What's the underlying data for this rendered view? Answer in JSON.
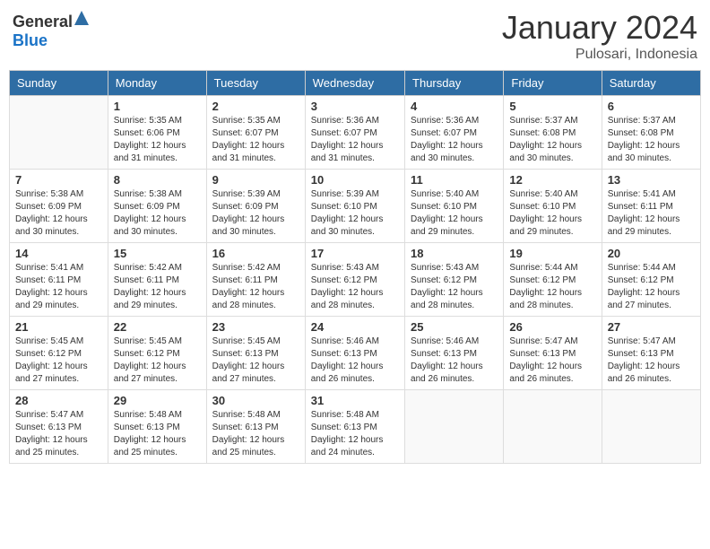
{
  "logo": {
    "text_general": "General",
    "text_blue": "Blue"
  },
  "title": "January 2024",
  "subtitle": "Pulosari, Indonesia",
  "days_of_week": [
    "Sunday",
    "Monday",
    "Tuesday",
    "Wednesday",
    "Thursday",
    "Friday",
    "Saturday"
  ],
  "weeks": [
    [
      {
        "day": "",
        "sunrise": "",
        "sunset": "",
        "daylight": ""
      },
      {
        "day": "1",
        "sunrise": "Sunrise: 5:35 AM",
        "sunset": "Sunset: 6:06 PM",
        "daylight": "Daylight: 12 hours and 31 minutes."
      },
      {
        "day": "2",
        "sunrise": "Sunrise: 5:35 AM",
        "sunset": "Sunset: 6:07 PM",
        "daylight": "Daylight: 12 hours and 31 minutes."
      },
      {
        "day": "3",
        "sunrise": "Sunrise: 5:36 AM",
        "sunset": "Sunset: 6:07 PM",
        "daylight": "Daylight: 12 hours and 31 minutes."
      },
      {
        "day": "4",
        "sunrise": "Sunrise: 5:36 AM",
        "sunset": "Sunset: 6:07 PM",
        "daylight": "Daylight: 12 hours and 30 minutes."
      },
      {
        "day": "5",
        "sunrise": "Sunrise: 5:37 AM",
        "sunset": "Sunset: 6:08 PM",
        "daylight": "Daylight: 12 hours and 30 minutes."
      },
      {
        "day": "6",
        "sunrise": "Sunrise: 5:37 AM",
        "sunset": "Sunset: 6:08 PM",
        "daylight": "Daylight: 12 hours and 30 minutes."
      }
    ],
    [
      {
        "day": "7",
        "sunrise": "Sunrise: 5:38 AM",
        "sunset": "Sunset: 6:09 PM",
        "daylight": "Daylight: 12 hours and 30 minutes."
      },
      {
        "day": "8",
        "sunrise": "Sunrise: 5:38 AM",
        "sunset": "Sunset: 6:09 PM",
        "daylight": "Daylight: 12 hours and 30 minutes."
      },
      {
        "day": "9",
        "sunrise": "Sunrise: 5:39 AM",
        "sunset": "Sunset: 6:09 PM",
        "daylight": "Daylight: 12 hours and 30 minutes."
      },
      {
        "day": "10",
        "sunrise": "Sunrise: 5:39 AM",
        "sunset": "Sunset: 6:10 PM",
        "daylight": "Daylight: 12 hours and 30 minutes."
      },
      {
        "day": "11",
        "sunrise": "Sunrise: 5:40 AM",
        "sunset": "Sunset: 6:10 PM",
        "daylight": "Daylight: 12 hours and 29 minutes."
      },
      {
        "day": "12",
        "sunrise": "Sunrise: 5:40 AM",
        "sunset": "Sunset: 6:10 PM",
        "daylight": "Daylight: 12 hours and 29 minutes."
      },
      {
        "day": "13",
        "sunrise": "Sunrise: 5:41 AM",
        "sunset": "Sunset: 6:11 PM",
        "daylight": "Daylight: 12 hours and 29 minutes."
      }
    ],
    [
      {
        "day": "14",
        "sunrise": "Sunrise: 5:41 AM",
        "sunset": "Sunset: 6:11 PM",
        "daylight": "Daylight: 12 hours and 29 minutes."
      },
      {
        "day": "15",
        "sunrise": "Sunrise: 5:42 AM",
        "sunset": "Sunset: 6:11 PM",
        "daylight": "Daylight: 12 hours and 29 minutes."
      },
      {
        "day": "16",
        "sunrise": "Sunrise: 5:42 AM",
        "sunset": "Sunset: 6:11 PM",
        "daylight": "Daylight: 12 hours and 28 minutes."
      },
      {
        "day": "17",
        "sunrise": "Sunrise: 5:43 AM",
        "sunset": "Sunset: 6:12 PM",
        "daylight": "Daylight: 12 hours and 28 minutes."
      },
      {
        "day": "18",
        "sunrise": "Sunrise: 5:43 AM",
        "sunset": "Sunset: 6:12 PM",
        "daylight": "Daylight: 12 hours and 28 minutes."
      },
      {
        "day": "19",
        "sunrise": "Sunrise: 5:44 AM",
        "sunset": "Sunset: 6:12 PM",
        "daylight": "Daylight: 12 hours and 28 minutes."
      },
      {
        "day": "20",
        "sunrise": "Sunrise: 5:44 AM",
        "sunset": "Sunset: 6:12 PM",
        "daylight": "Daylight: 12 hours and 27 minutes."
      }
    ],
    [
      {
        "day": "21",
        "sunrise": "Sunrise: 5:45 AM",
        "sunset": "Sunset: 6:12 PM",
        "daylight": "Daylight: 12 hours and 27 minutes."
      },
      {
        "day": "22",
        "sunrise": "Sunrise: 5:45 AM",
        "sunset": "Sunset: 6:12 PM",
        "daylight": "Daylight: 12 hours and 27 minutes."
      },
      {
        "day": "23",
        "sunrise": "Sunrise: 5:45 AM",
        "sunset": "Sunset: 6:13 PM",
        "daylight": "Daylight: 12 hours and 27 minutes."
      },
      {
        "day": "24",
        "sunrise": "Sunrise: 5:46 AM",
        "sunset": "Sunset: 6:13 PM",
        "daylight": "Daylight: 12 hours and 26 minutes."
      },
      {
        "day": "25",
        "sunrise": "Sunrise: 5:46 AM",
        "sunset": "Sunset: 6:13 PM",
        "daylight": "Daylight: 12 hours and 26 minutes."
      },
      {
        "day": "26",
        "sunrise": "Sunrise: 5:47 AM",
        "sunset": "Sunset: 6:13 PM",
        "daylight": "Daylight: 12 hours and 26 minutes."
      },
      {
        "day": "27",
        "sunrise": "Sunrise: 5:47 AM",
        "sunset": "Sunset: 6:13 PM",
        "daylight": "Daylight: 12 hours and 26 minutes."
      }
    ],
    [
      {
        "day": "28",
        "sunrise": "Sunrise: 5:47 AM",
        "sunset": "Sunset: 6:13 PM",
        "daylight": "Daylight: 12 hours and 25 minutes."
      },
      {
        "day": "29",
        "sunrise": "Sunrise: 5:48 AM",
        "sunset": "Sunset: 6:13 PM",
        "daylight": "Daylight: 12 hours and 25 minutes."
      },
      {
        "day": "30",
        "sunrise": "Sunrise: 5:48 AM",
        "sunset": "Sunset: 6:13 PM",
        "daylight": "Daylight: 12 hours and 25 minutes."
      },
      {
        "day": "31",
        "sunrise": "Sunrise: 5:48 AM",
        "sunset": "Sunset: 6:13 PM",
        "daylight": "Daylight: 12 hours and 24 minutes."
      },
      {
        "day": "",
        "sunrise": "",
        "sunset": "",
        "daylight": ""
      },
      {
        "day": "",
        "sunrise": "",
        "sunset": "",
        "daylight": ""
      },
      {
        "day": "",
        "sunrise": "",
        "sunset": "",
        "daylight": ""
      }
    ]
  ]
}
